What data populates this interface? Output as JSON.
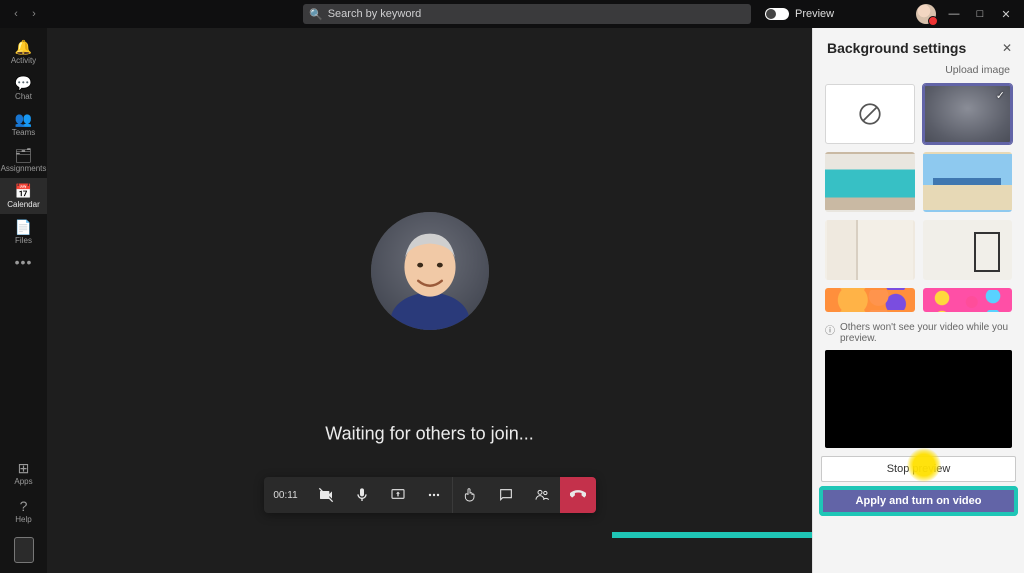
{
  "titlebar": {
    "search_placeholder": "Search by keyword",
    "preview_label": "Preview"
  },
  "rail": {
    "items": [
      {
        "id": "activity",
        "icon": "🔔",
        "label": "Activity"
      },
      {
        "id": "chat",
        "icon": "💬",
        "label": "Chat"
      },
      {
        "id": "teams",
        "icon": "👥",
        "label": "Teams"
      },
      {
        "id": "assignments",
        "icon": "🗂",
        "label": "Assignments"
      },
      {
        "id": "calendar",
        "icon": "📅",
        "label": "Calendar"
      },
      {
        "id": "files",
        "icon": "📄",
        "label": "Files"
      }
    ],
    "active_id": "calendar",
    "bottom": [
      {
        "id": "apps",
        "icon": "⊞",
        "label": "Apps"
      },
      {
        "id": "help",
        "icon": "?",
        "label": "Help"
      }
    ]
  },
  "meeting": {
    "status_text": "Waiting for others to join...",
    "timer": "00:11",
    "controls": [
      {
        "id": "camera",
        "name": "camera-toggle-button"
      },
      {
        "id": "mic",
        "name": "mic-toggle-button"
      },
      {
        "id": "share",
        "name": "share-screen-button"
      },
      {
        "id": "more",
        "name": "more-actions-button"
      },
      {
        "id": "raise",
        "name": "raise-hand-button"
      },
      {
        "id": "chat",
        "name": "meeting-chat-button"
      },
      {
        "id": "people",
        "name": "participants-button"
      },
      {
        "id": "hangup",
        "name": "hangup-button"
      }
    ]
  },
  "panel": {
    "title": "Background settings",
    "upload_label": "Upload image",
    "note_text": "Others won't see your video while you preview.",
    "options": [
      {
        "id": "none",
        "kind": "none",
        "selected": false
      },
      {
        "id": "blur",
        "kind": "blur",
        "selected": true
      },
      {
        "id": "img1",
        "kind": "image",
        "selected": false
      },
      {
        "id": "img2",
        "kind": "image",
        "selected": false
      },
      {
        "id": "img3",
        "kind": "image",
        "selected": false
      },
      {
        "id": "img4",
        "kind": "image",
        "selected": false
      },
      {
        "id": "img5",
        "kind": "image",
        "selected": false
      },
      {
        "id": "img6",
        "kind": "image",
        "selected": false
      }
    ],
    "stop_preview_label": "Stop preview",
    "apply_label": "Apply and turn on video"
  }
}
